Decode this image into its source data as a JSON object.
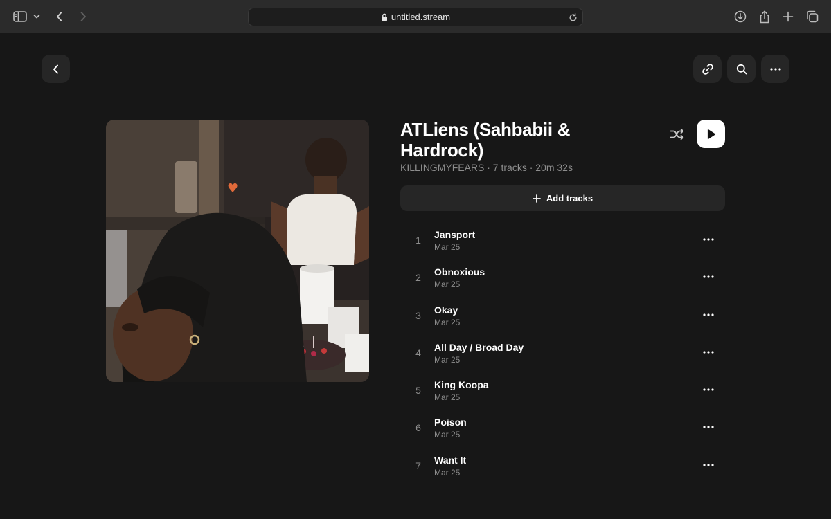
{
  "browser": {
    "url": "untitled.stream"
  },
  "playlist": {
    "title": "ATLiens (Sahbabii & Hardrock)",
    "meta": "KILLINGMYFEARS · 7 tracks · 20m 32s",
    "add_tracks_label": "Add tracks",
    "tracks": [
      {
        "number": "1",
        "name": "Jansport",
        "date": "Mar 25"
      },
      {
        "number": "2",
        "name": "Obnoxious",
        "date": "Mar 25"
      },
      {
        "number": "3",
        "name": "Okay",
        "date": "Mar 25"
      },
      {
        "number": "4",
        "name": "All Day / Broad Day",
        "date": "Mar 25"
      },
      {
        "number": "5",
        "name": "King Koopa",
        "date": "Mar 25"
      },
      {
        "number": "6",
        "name": "Poison",
        "date": "Mar 25"
      },
      {
        "number": "7",
        "name": "Want It",
        "date": "Mar 25"
      }
    ]
  },
  "icons": {
    "chrome": [
      "sidebar-icon",
      "chevron-down-icon",
      "back-icon",
      "forward-icon",
      "lock-icon",
      "reload-icon",
      "download-icon",
      "share-icon",
      "new-tab-icon",
      "tabs-overview-icon"
    ],
    "page": [
      "back-icon",
      "link-icon",
      "search-icon",
      "more-icon",
      "shuffle-icon",
      "play-icon",
      "plus-icon"
    ]
  },
  "colors": {
    "background": "#171717",
    "surface": "#262626",
    "text_secondary": "#8d8d8d",
    "play_button": "#ffffff"
  }
}
